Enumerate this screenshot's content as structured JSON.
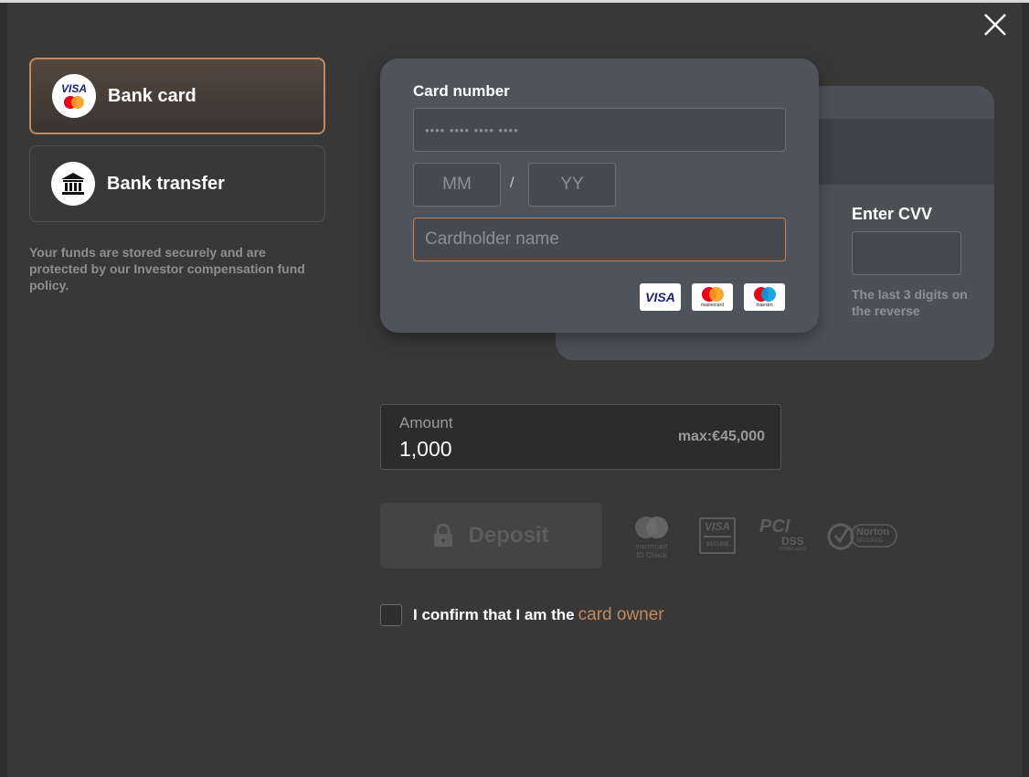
{
  "payment_methods": [
    {
      "label": "Bank card",
      "icon": "visa-mastercard-icon",
      "active": true
    },
    {
      "label": "Bank transfer",
      "icon": "bank-icon",
      "active": false
    }
  ],
  "security_note": "Your funds are stored securely and are protected by our Investor compensation fund policy.",
  "card": {
    "number_label": "Card number",
    "number_placeholder": "•••• •••• •••• ••••",
    "month_placeholder": "MM",
    "slash": "/",
    "year_placeholder": "YY",
    "holder_placeholder": "Cardholder name",
    "cvv_label": "Enter CVV",
    "cvv_hint": "The last 3 digits on the reverse",
    "brands": {
      "visa": "VISA",
      "mastercard": "mastercard",
      "maestro": "maestro"
    }
  },
  "amount": {
    "label": "Amount",
    "value": "1,000",
    "max": "max:€45,000"
  },
  "deposit_label": "Deposit",
  "security_logos": {
    "mc_line1": "mastercard",
    "mc_line2": "ID Check",
    "visa_line1": "VISA",
    "visa_line2": "SECURE",
    "pci_line1": "PCI",
    "pci_line2": "DSS",
    "pci_line3": "COMPLIANT",
    "norton_line1": "Norton",
    "norton_line2": "SECURED"
  },
  "confirm": {
    "text": "I confirm that I am the",
    "link": "card owner"
  },
  "colors": {
    "accent": "#c48a5e",
    "background": "#383838",
    "card": "#4f545a"
  }
}
